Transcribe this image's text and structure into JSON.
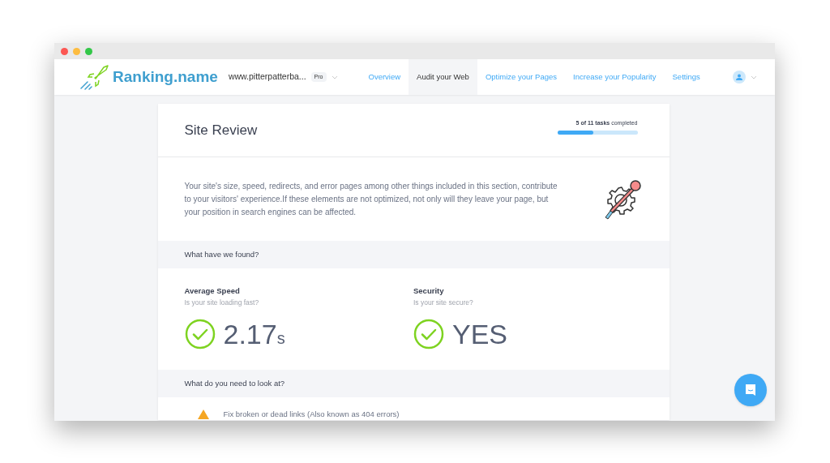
{
  "brand": {
    "name": "Ranking.name"
  },
  "site": {
    "url": "www.pitterpatterba...",
    "plan": "Pro"
  },
  "nav": [
    {
      "label": "Overview",
      "selected": false
    },
    {
      "label": "Audit your Web",
      "selected": true
    },
    {
      "label": "Optimize your Pages",
      "selected": false
    },
    {
      "label": "Increase your Popularity",
      "selected": false
    },
    {
      "label": "Settings",
      "selected": false
    }
  ],
  "review": {
    "title": "Site Review",
    "progress_count": "5 of 11 tasks",
    "progress_suffix": "completed",
    "level": 0.45,
    "description": "Your site's size, speed, redirects, and error pages among other things included in this section, contribute to your visitors' experience.If these elements are not optimized, not only will they leave your page, but your position in search engines can be affected."
  },
  "found": {
    "heading": "What have we found?",
    "metrics": [
      {
        "title": "Average Speed",
        "question": "Is your site loading fast?",
        "value": "2.17",
        "unit": "s",
        "passed": true
      },
      {
        "title": "Security",
        "question": "Is your site secure?",
        "value": "YES",
        "passed": true
      }
    ]
  },
  "todo": {
    "heading": "What do you need to look at?",
    "items": [
      {
        "text": "Fix broken or dead links (Also known as 404 errors)",
        "kind": "warning"
      }
    ]
  }
}
